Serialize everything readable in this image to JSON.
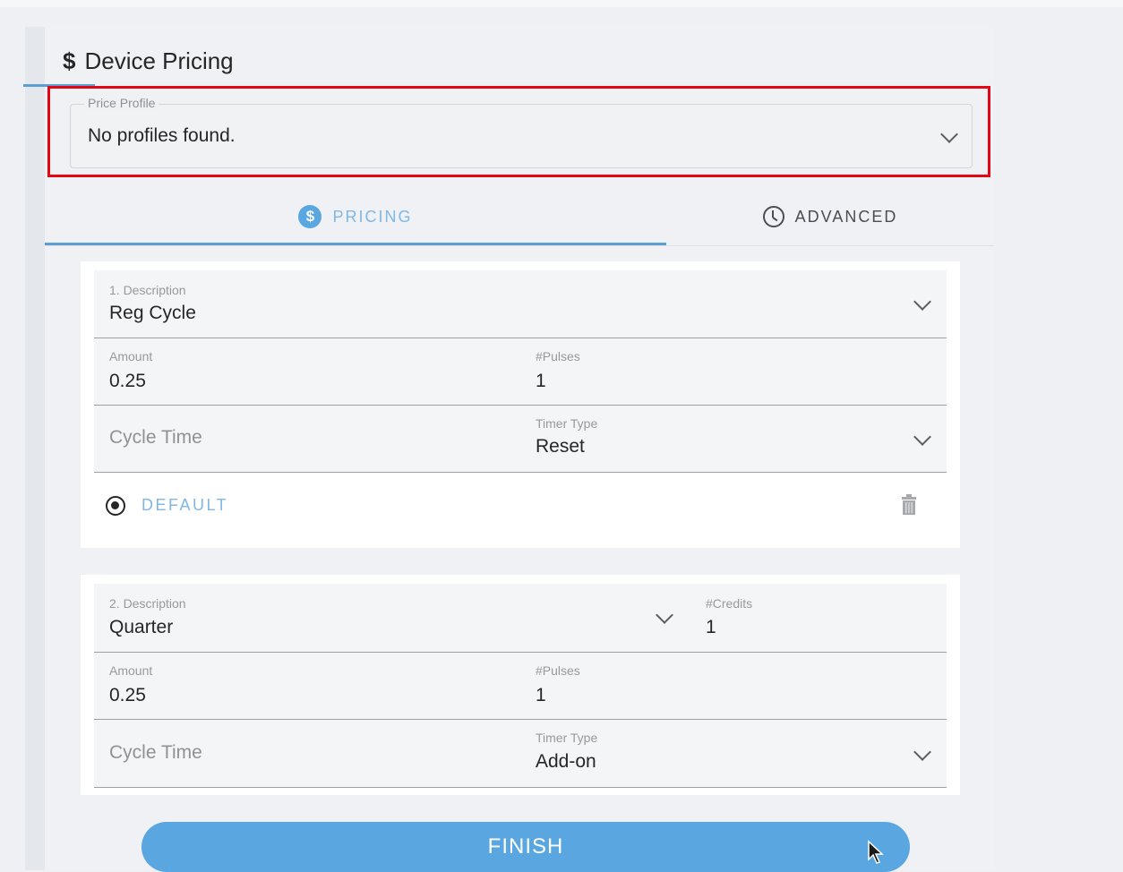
{
  "header": {
    "icon": "dollar-icon",
    "symbol": "$",
    "title": "Device Pricing"
  },
  "price_profile": {
    "label": "Price Profile",
    "value": "No profiles found."
  },
  "tabs": [
    {
      "label": "PRICING",
      "icon": "dollar-coin-icon",
      "active": true
    },
    {
      "label": "ADVANCED",
      "icon": "clock-icon",
      "active": false
    }
  ],
  "pricing_items": [
    {
      "description_label": "1. Description",
      "description_value": "Reg Cycle",
      "amount_label": "Amount",
      "amount_value": "0.25",
      "pulses_label": "#Pulses",
      "pulses_value": "1",
      "cycle_time_placeholder": "Cycle Time",
      "timer_type_label": "Timer Type",
      "timer_type_value": "Reset",
      "default_label": "DEFAULT"
    },
    {
      "description_label": "2. Description",
      "description_value": "Quarter",
      "credits_label": "#Credits",
      "credits_value": "1",
      "amount_label": "Amount",
      "amount_value": "0.25",
      "pulses_label": "#Pulses",
      "pulses_value": "1",
      "cycle_time_placeholder": "Cycle Time",
      "timer_type_label": "Timer Type",
      "timer_type_value": "Add-on"
    }
  ],
  "finish_label": "FINISH",
  "colors": {
    "accent": "#5aa6e0",
    "highlight_box": "#e30613"
  }
}
